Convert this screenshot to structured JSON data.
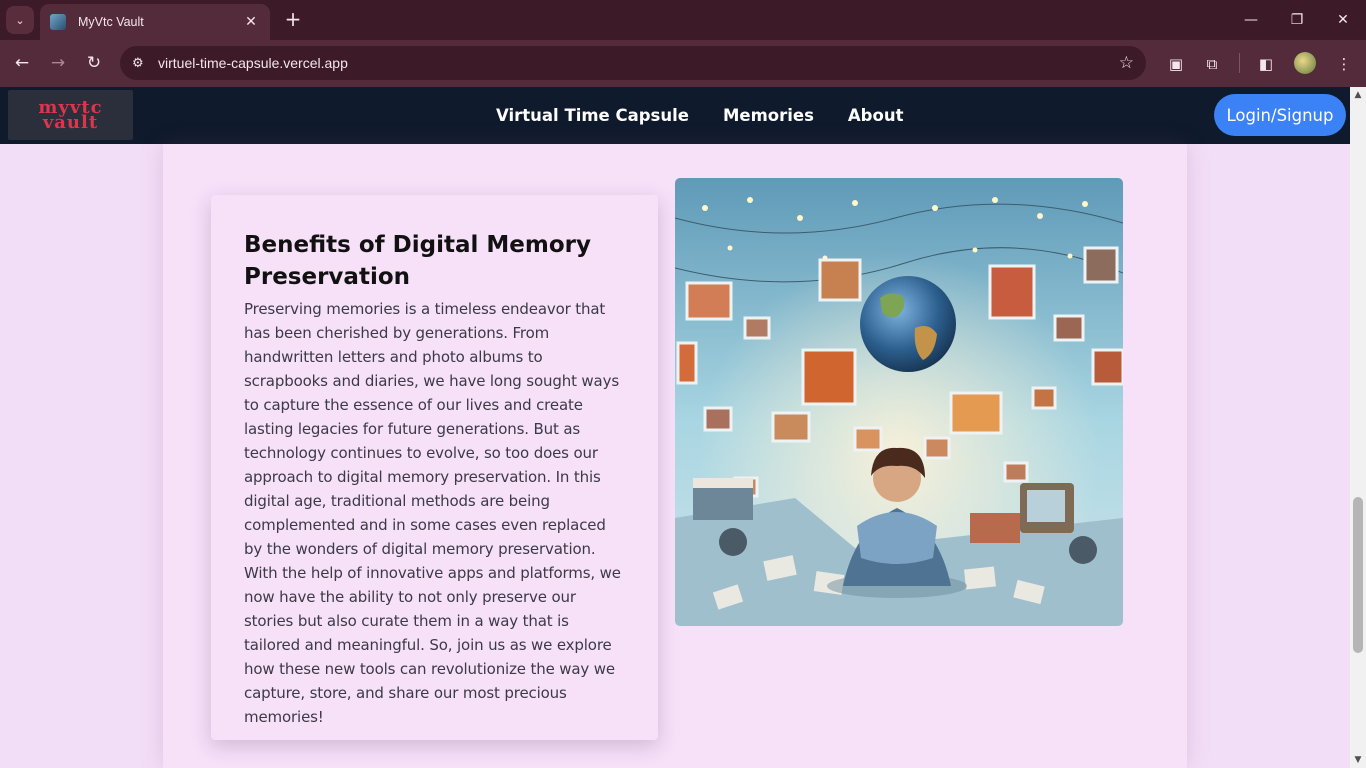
{
  "browser": {
    "tab_title": "MyVtc Vault",
    "url": "virtuel-time-capsule.vercel.app"
  },
  "site": {
    "logo_line1": "myvtc",
    "logo_line2": "vault",
    "nav": [
      {
        "label": "Virtual Time Capsule"
      },
      {
        "label": "Memories"
      },
      {
        "label": "About"
      }
    ],
    "login_label": "Login/Signup"
  },
  "section": {
    "title": "Benefits of Digital Memory Preservation",
    "body": "Preserving memories is a timeless endeavor that has been cherished by generations. From handwritten letters and photo albums to scrapbooks and diaries, we have long sought ways to capture the essence of our lives and create lasting legacies for future generations. But as technology continues to evolve, so too does our approach to digital memory preservation. In this digital age, traditional methods are being complemented and in some cases even replaced by the wonders of digital memory preservation. With the help of innovative apps and platforms, we now have the ability to not only preserve our stories but also curate them in a way that is tailored and meaningful. So, join us as we explore how these new tools can revolutionize the way we capture, store, and share our most precious memories!"
  },
  "colors": {
    "navbar": "#0f1a2c",
    "accent_button": "#3b82f6",
    "page_bg": "#f3def7",
    "logo_text": "#e0344c"
  }
}
